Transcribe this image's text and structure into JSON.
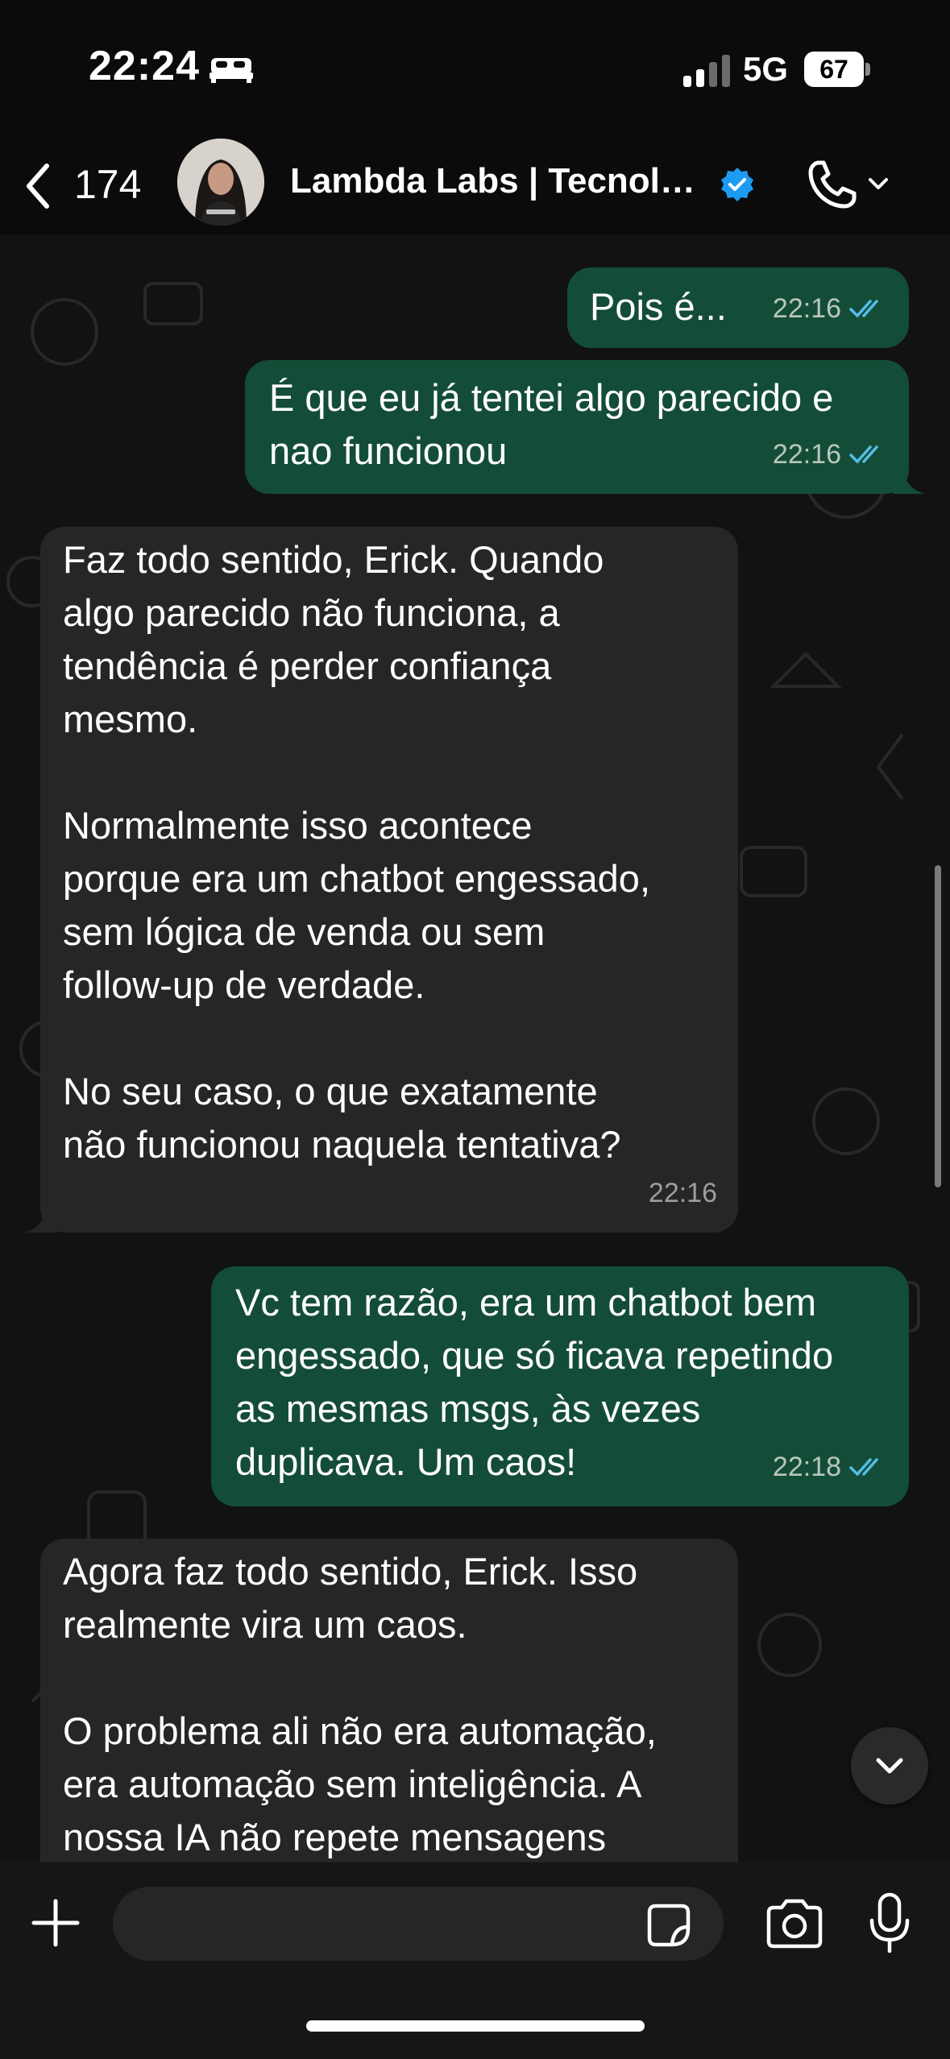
{
  "status_bar": {
    "time": "22:24",
    "network": "5G",
    "battery": "67"
  },
  "header": {
    "back_count": "174",
    "contact_name": "Lambda Labs | Tecnolo...",
    "verified_icon": "verified-badge-icon",
    "call_icon": "phone-icon"
  },
  "messages": [
    {
      "direction": "out",
      "text": "Pois é...",
      "time": "22:16",
      "read": true
    },
    {
      "direction": "out",
      "text": "É que eu já tentei algo parecido e\nnao funcionou",
      "time": "22:16",
      "read": true
    },
    {
      "direction": "in",
      "text": "Faz todo sentido, Erick. Quando\nalgo parecido não funciona, a\ntendência é perder confiança\nmesmo.\n\nNormalmente isso acontece\nporque era um chatbot engessado,\nsem lógica de venda ou sem\nfollow-up de verdade.\n\nNo seu caso, o que exatamente\nnão funcionou naquela tentativa?",
      "time": "22:16"
    },
    {
      "direction": "out",
      "text": "Vc tem razão, era um chatbot bem\nengessado, que só ficava repetindo\nas mesmas msgs, às vezes\nduplicava. Um caos!",
      "time": "22:18",
      "read": true
    },
    {
      "direction": "in",
      "text": "Agora faz todo sentido, Erick. Isso\nrealmente vira um caos.\n\nO problema ali não era automação,\nera automação sem inteligência. A\nnossa IA não repete mensagens",
      "time": ""
    }
  ],
  "input": {
    "value": "",
    "placeholder": ""
  },
  "colors": {
    "outgoing_bubble": "#144d37",
    "incoming_bubble": "#262626",
    "read_ticks": "#53bdeb",
    "background": "#0b0b0b",
    "verified": "#1d9bf0"
  }
}
